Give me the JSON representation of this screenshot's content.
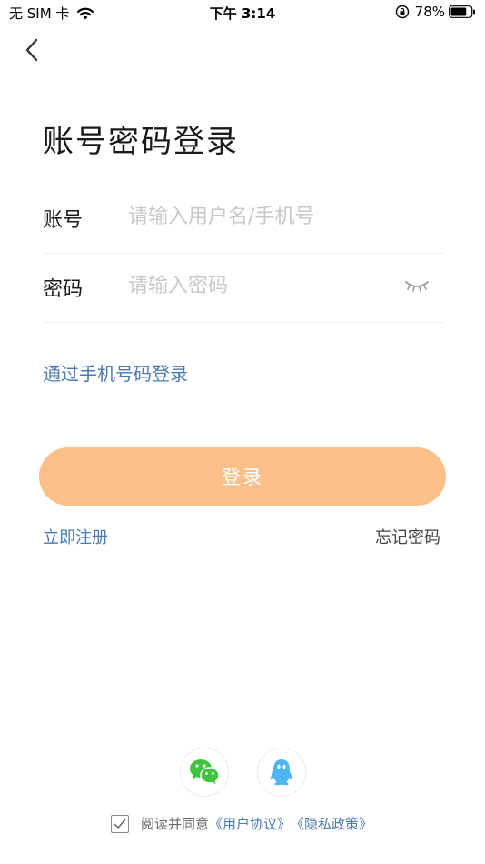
{
  "status_bar": {
    "carrier": "无 SIM 卡",
    "time": "下午 3:14",
    "battery_percent": "78%",
    "battery_level": 0.78
  },
  "header": {
    "back_icon": "chevron-left-icon"
  },
  "title": "账号密码登录",
  "form": {
    "account": {
      "label": "账号",
      "placeholder": "请输入用户名/手机号",
      "value": ""
    },
    "password": {
      "label": "密码",
      "placeholder": "请输入密码",
      "value": "",
      "toggle_icon": "eye-closed-icon"
    }
  },
  "phone_login_link": "通过手机号码登录",
  "login_button": "登录",
  "register_link": "立即注册",
  "forgot_link": "忘记密码",
  "social": [
    {
      "name": "wechat",
      "icon": "wechat-icon",
      "color": "#3fc43f"
    },
    {
      "name": "qq",
      "icon": "qq-icon",
      "color": "#4fb5f5"
    }
  ],
  "agreement": {
    "checked": true,
    "prefix": "阅读并同意",
    "user_agreement": "《用户协议》",
    "privacy_policy": "《隐私政策》"
  },
  "colors": {
    "accent_link": "#4a7ab0",
    "login_button_bg": "#fbc08a",
    "placeholder": "#c8c8c8"
  }
}
